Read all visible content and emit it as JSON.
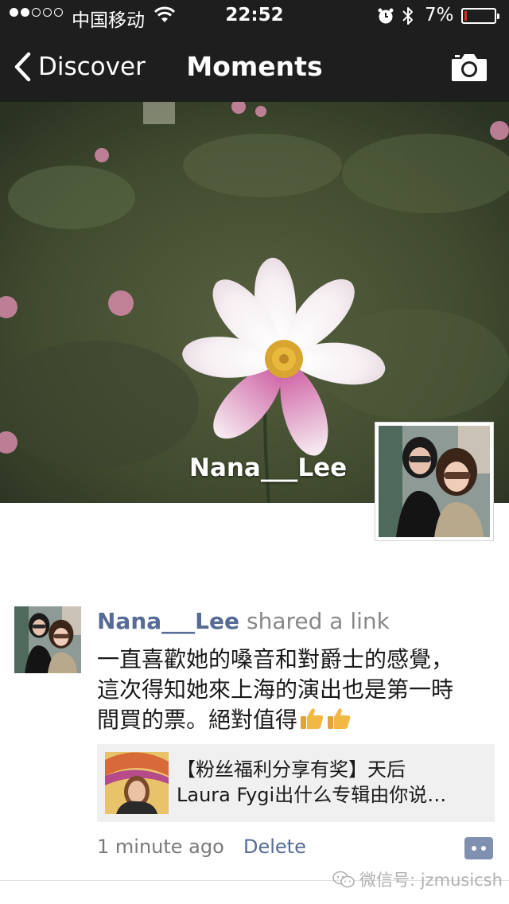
{
  "status_bar": {
    "carrier": "中国移动",
    "time": "22:52",
    "battery_percent": "7%",
    "battery_level": 0.07,
    "signal_bars_filled": 2,
    "signal_bars_total": 5,
    "icons": [
      "wifi-icon",
      "alarm-icon",
      "bluetooth-icon",
      "battery-icon"
    ]
  },
  "nav": {
    "back_label": "Discover",
    "title": "Moments",
    "right_icon": "camera-icon"
  },
  "cover": {
    "user_name": "Nana___Lee"
  },
  "post": {
    "author": "Nana___Lee",
    "action": "shared a link",
    "text_lines": [
      "一直喜歡她的嗓音和對爵士的感覺，",
      "這次得知她來上海的演出也是第一時",
      "間買的票。絕對值得"
    ],
    "emoji": [
      "thumbs-up-icon",
      "thumbs-up-icon"
    ],
    "link": {
      "title_lines": [
        "【粉丝福利分享有奖】天后",
        "Laura Fygi出什么专辑由你说…"
      ]
    },
    "time": "1 minute ago",
    "delete_label": "Delete",
    "comment_icon": "comment-icon"
  },
  "watermark": {
    "text": "微信号: jzmusicsh"
  },
  "colors": {
    "bar_background": "#1e1e1e",
    "link_blue": "#566b95",
    "battery_red": "#e8262a",
    "card_background": "#f0f0f0"
  }
}
